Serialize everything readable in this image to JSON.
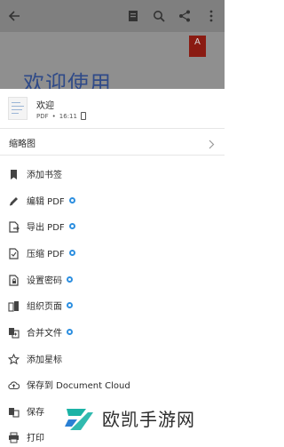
{
  "app_background": {
    "title": "欢迎使用",
    "brand_badge": "A",
    "toolbar_icons": [
      "back-arrow-icon",
      "view-mode-icon",
      "search-icon",
      "share-icon",
      "more-vertical-icon"
    ]
  },
  "file": {
    "name": "欢迎",
    "type": "PDF",
    "separator": "•",
    "time": "16:11"
  },
  "thumbnail_row": {
    "label": "缩略图"
  },
  "menu": [
    {
      "label": "添加书签",
      "icon": "bookmark-icon",
      "premium": false
    },
    {
      "label": "编辑 PDF",
      "icon": "pencil-icon",
      "premium": true
    },
    {
      "label": "导出 PDF",
      "icon": "export-pdf-icon",
      "premium": true
    },
    {
      "label": "压缩 PDF",
      "icon": "compress-pdf-icon",
      "premium": true
    },
    {
      "label": "设置密码",
      "icon": "lock-file-icon",
      "premium": true
    },
    {
      "label": "组织页面",
      "icon": "organize-pages-icon",
      "premium": true
    },
    {
      "label": "合并文件",
      "icon": "combine-files-icon",
      "premium": true
    },
    {
      "label": "添加星标",
      "icon": "star-icon",
      "premium": false
    },
    {
      "label": "保存到 Document Cloud",
      "icon": "cloud-upload-icon",
      "premium": false
    },
    {
      "label": "保存",
      "icon": "save-copy-icon",
      "premium": false
    },
    {
      "label": "打印",
      "icon": "printer-icon",
      "premium": false
    }
  ],
  "watermark": {
    "text": "欧凯手游网"
  },
  "colors": {
    "accent_blue": "#2d8fe0",
    "title_blue": "#2f4a88",
    "adobe_red": "#8a1b12",
    "overlay_gray": "#8f8f8f"
  }
}
